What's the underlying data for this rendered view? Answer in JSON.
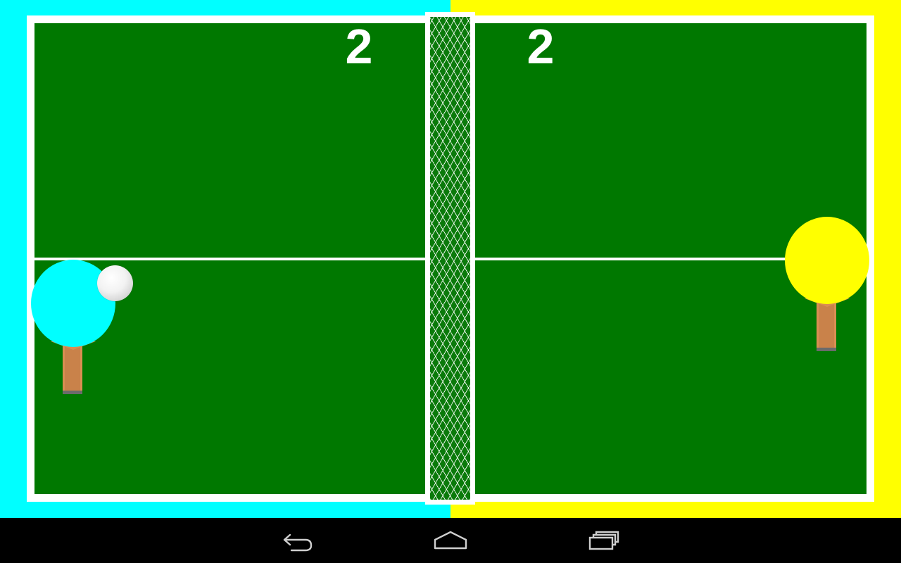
{
  "colors": {
    "player_left": "#00ffff",
    "player_right": "#ffff00",
    "table": "#007800",
    "lines": "#ffffff",
    "handle": "#d98e52",
    "navbar": "#000000"
  },
  "scores": {
    "left": "2",
    "right": "2"
  },
  "paddles": {
    "left": {
      "color_name": "cyan",
      "icon": "paddle-icon"
    },
    "right": {
      "color_name": "yellow",
      "icon": "paddle-icon"
    }
  },
  "ball": {
    "icon": "ball-icon"
  },
  "navbar": {
    "buttons": [
      {
        "name": "back",
        "icon": "back-arrow-icon"
      },
      {
        "name": "home",
        "icon": "home-icon"
      },
      {
        "name": "recents",
        "icon": "recent-apps-icon"
      }
    ]
  }
}
